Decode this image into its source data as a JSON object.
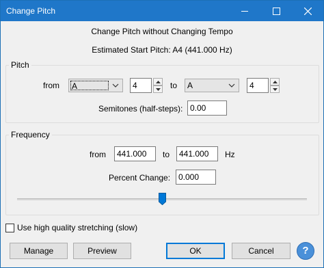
{
  "window": {
    "title": "Change Pitch"
  },
  "header": {
    "heading": "Change Pitch without Changing Tempo",
    "estimated": "Estimated Start Pitch: A4 (441.000 Hz)"
  },
  "pitch": {
    "group_label": "Pitch",
    "from_label": "from",
    "from_note": "A",
    "from_octave": "4",
    "to_label": "to",
    "to_note": "A",
    "to_octave": "4",
    "semitones_label": "Semitones (half-steps):",
    "semitones_value": "0.00"
  },
  "frequency": {
    "group_label": "Frequency",
    "from_label": "from",
    "from_value": "441.000",
    "to_label": "to",
    "to_value": "441.000",
    "unit": "Hz",
    "percent_label": "Percent Change:",
    "percent_value": "0.000",
    "slider_level": 0.5
  },
  "options": {
    "high_quality_label": "Use high quality stretching (slow)",
    "high_quality_checked": false
  },
  "buttons": {
    "manage": "Manage",
    "preview": "Preview",
    "ok": "OK",
    "cancel": "Cancel",
    "help": "?"
  },
  "colors": {
    "titlebar": "#1f77c9",
    "accent": "#0078d7",
    "slider_thumb": "#0078d7",
    "help": "#4a90d9"
  }
}
